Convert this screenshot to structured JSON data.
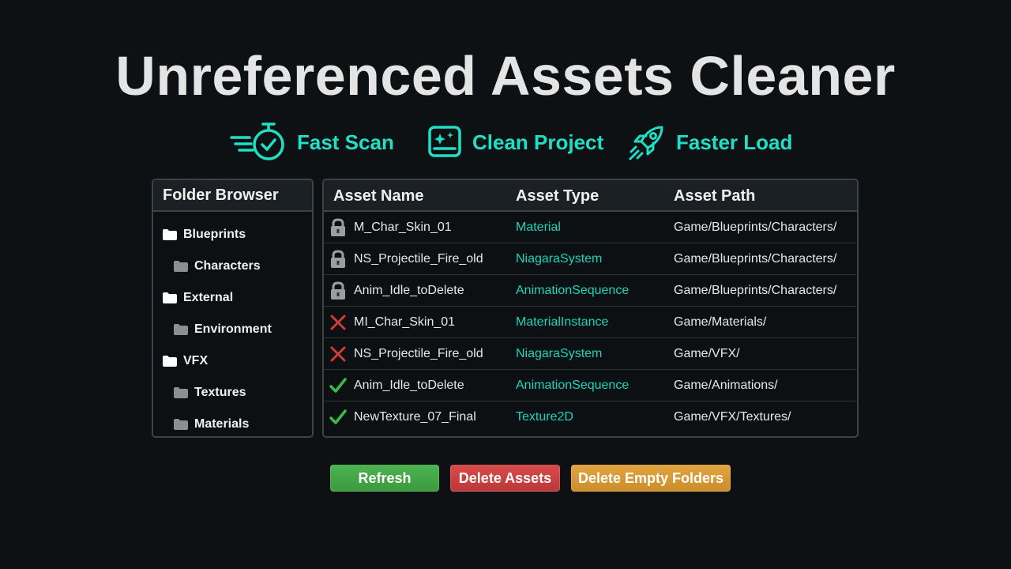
{
  "title": "Unreferenced Assets Cleaner",
  "features": [
    {
      "icon": "stopwatch-icon",
      "label": "Fast Scan"
    },
    {
      "icon": "sparkle-window-icon",
      "label": "Clean Project"
    },
    {
      "icon": "rocket-icon",
      "label": "Faster Load"
    }
  ],
  "folder_browser": {
    "title": "Folder Browser",
    "items": [
      {
        "label": "Blueprints",
        "level": 0
      },
      {
        "label": "Characters",
        "level": 1
      },
      {
        "label": "External",
        "level": 0
      },
      {
        "label": "Environment",
        "level": 1
      },
      {
        "label": "VFX",
        "level": 0
      },
      {
        "label": "Textures",
        "level": 1
      },
      {
        "label": "Materials",
        "level": 1
      }
    ]
  },
  "asset_table": {
    "columns": [
      "Asset Name",
      "Asset Type",
      "Asset Path"
    ],
    "rows": [
      {
        "status": "lock-icon",
        "name": "M_Char_Skin_01",
        "type": "Material",
        "path": "Game/Blueprints/Characters/"
      },
      {
        "status": "lock-icon",
        "name": "NS_Projectile_Fire_old",
        "type": "NiagaraSystem",
        "path": "Game/Blueprints/Characters/"
      },
      {
        "status": "lock-icon",
        "name": "Anim_Idle_toDelete",
        "type": "AnimationSequence",
        "path": "Game/Blueprints/Characters/"
      },
      {
        "status": "cross-icon",
        "name": "MI_Char_Skin_01",
        "type": "MaterialInstance",
        "path": "Game/Materials/"
      },
      {
        "status": "cross-icon",
        "name": "NS_Projectile_Fire_old",
        "type": "NiagaraSystem",
        "path": "Game/VFX/"
      },
      {
        "status": "check-icon",
        "name": "Anim_Idle_toDelete",
        "type": "AnimationSequence",
        "path": "Game/Animations/"
      },
      {
        "status": "check-icon",
        "name": "NewTexture_07_Final",
        "type": "Texture2D",
        "path": "Game/VFX/Textures/"
      }
    ]
  },
  "buttons": {
    "refresh": "Refresh",
    "delete_assets": "Delete Assets",
    "delete_empty_folders": "Delete Empty Folders"
  },
  "colors": {
    "accent": "#1fe0c4",
    "refresh": "#45a848",
    "delete": "#cc4040",
    "empty_folders": "#d99a35"
  }
}
